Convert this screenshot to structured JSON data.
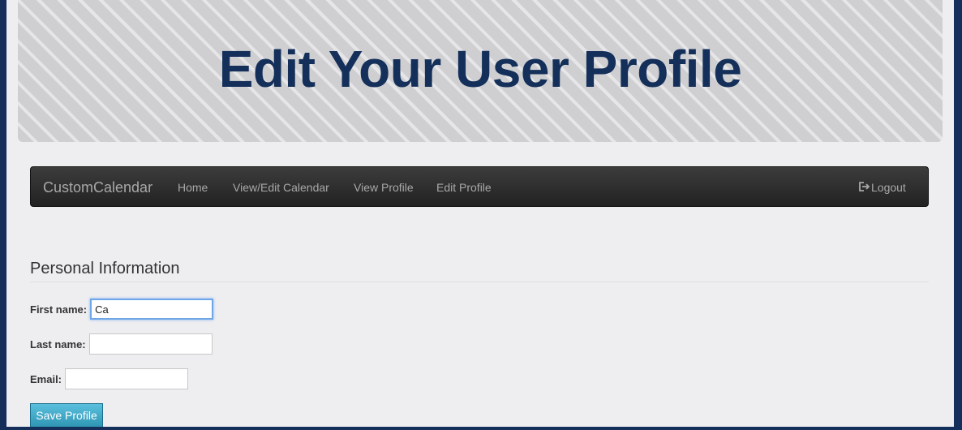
{
  "header": {
    "title": "Edit Your User Profile"
  },
  "navbar": {
    "brand": "CustomCalendar",
    "links": [
      {
        "label": "Home"
      },
      {
        "label": "View/Edit Calendar"
      },
      {
        "label": "View Profile"
      },
      {
        "label": "Edit Profile"
      }
    ],
    "logout_label": "Logout",
    "logout_icon": "logout-icon"
  },
  "form": {
    "section_title": "Personal Information",
    "first_name": {
      "label": "First name:",
      "value": "Ca"
    },
    "last_name": {
      "label": "Last name:",
      "value": ""
    },
    "email": {
      "label": "Email:",
      "value": ""
    },
    "save_label": "Save Profile"
  },
  "colors": {
    "page_border": "#14305a",
    "title": "#14305a",
    "save_button": "#5bc0de",
    "focus_ring": "#6ea6e8"
  }
}
